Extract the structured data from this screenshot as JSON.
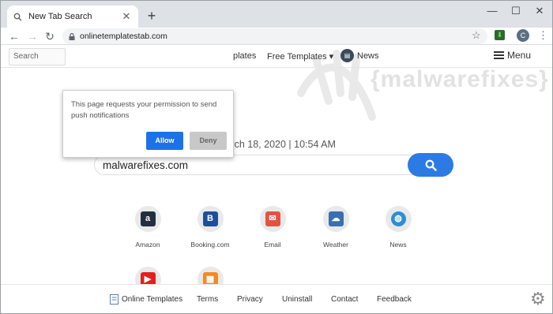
{
  "browser": {
    "tab_title": "New Tab Search",
    "tab_close": "✕",
    "new_tab": "+",
    "url": "onlinetemplatestab.com",
    "profile_initial": "C",
    "window_controls": {
      "minimize": "—",
      "maximize": "☐",
      "close": "✕"
    }
  },
  "topnav": {
    "search_placeholder": "Search",
    "templates_partial": "plates",
    "free_templates": "Free Templates ▾",
    "news": "News",
    "menu": "Menu"
  },
  "watermark": "{malwarefixes}",
  "datetime": "March 18, 2020 | 10:54 AM",
  "search": {
    "value": "malwarefixes.com"
  },
  "shortcuts": [
    {
      "label": "Amazon",
      "icon": "amazon-icon",
      "color": "#232f3e"
    },
    {
      "label": "Booking.com",
      "icon": "booking-icon",
      "color": "#1f4e98"
    },
    {
      "label": "Email",
      "icon": "email-icon",
      "color": "#e25442"
    },
    {
      "label": "Weather",
      "icon": "weather-icon",
      "color": "#3a6fb0"
    },
    {
      "label": "News",
      "icon": "globe-icon",
      "color": "#2b8fd6"
    },
    {
      "label": "",
      "icon": "youtube-icon",
      "color": "#e02020"
    },
    {
      "label": "",
      "icon": "news-paper-icon",
      "color": "#f08a24"
    }
  ],
  "footer": {
    "online_templates": "Online Templates",
    "terms": "Terms",
    "privacy": "Privacy",
    "uninstall": "Uninstall",
    "contact": "Contact",
    "feedback": "Feedback"
  },
  "popup": {
    "message": "This page requests your permission to send push notifications",
    "allow": "Allow",
    "deny": "Deny"
  }
}
